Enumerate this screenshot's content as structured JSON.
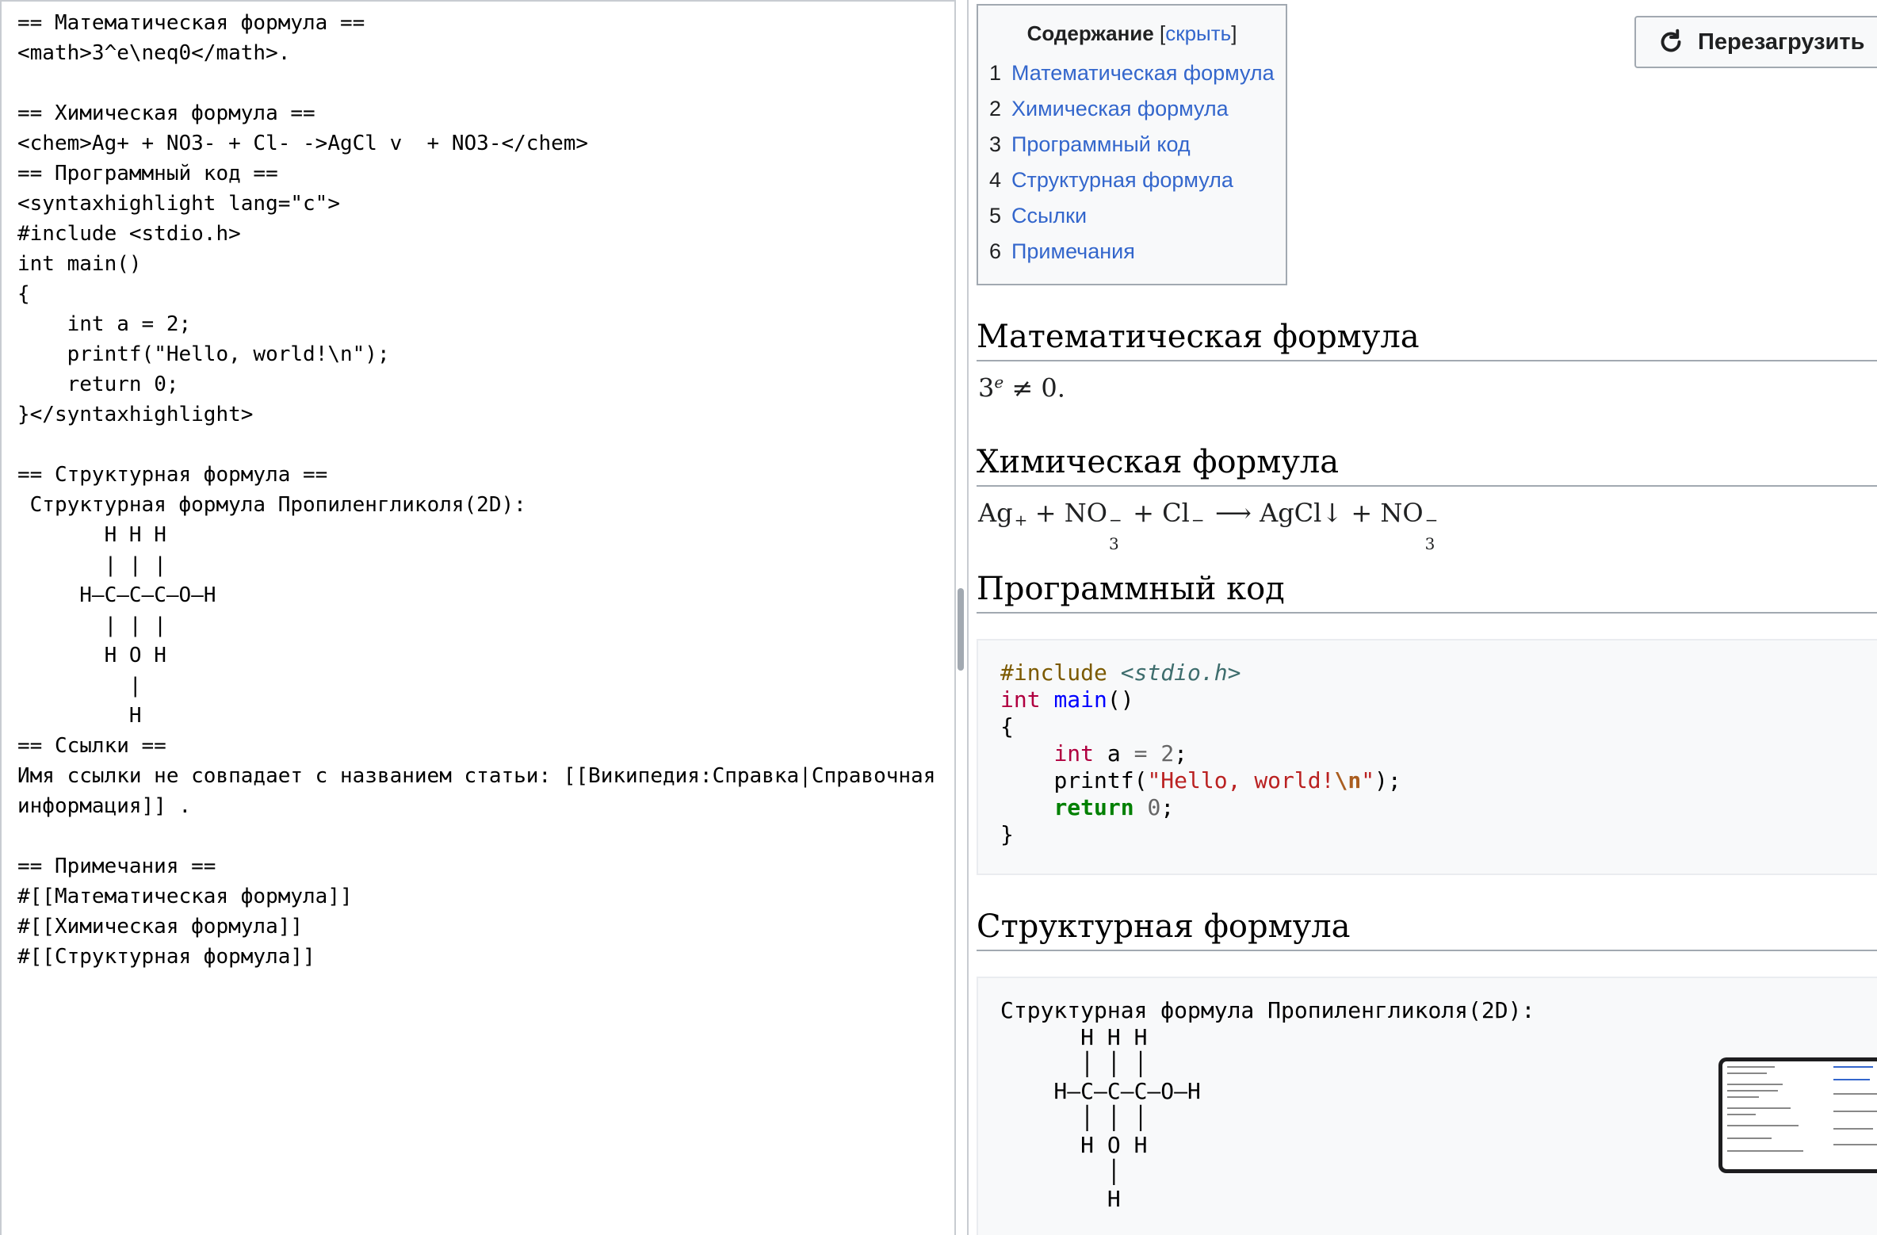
{
  "editor": {
    "text": "== Математическая формула ==\n<math>3^e\\neq0</math>.\n\n== Химическая формула ==\n<chem>Ag+ + NO3- + Cl- ->AgCl v  + NO3-</chem>\n== Программный код ==\n<syntaxhighlight lang=\"c\">\n#include <stdio.h>\nint main()\n{\n    int a = 2;\n    printf(\"Hello, world!\\n\");\n    return 0;\n}</syntaxhighlight>\n\n== Структурная формула ==\n Структурная формула Пропиленгликоля(2D):\n       H H H\n       | | |\n     H—C—C—C—O—H\n       | | |\n       H O H\n         |\n         H\n== Ссылки ==\nИмя ссылки не совпадает с названием статьи: [[Википедия:Справка|Справочная информация]] .\n\n== Примечания ==\n#[[Математическая формула]]\n#[[Химическая формула]]\n#[[Структурная формула]]"
  },
  "toc": {
    "title": "Содержание",
    "toggle_open": "[",
    "toggle": "скрыть",
    "toggle_close": "]",
    "items": [
      {
        "num": "1",
        "label": "Математическая формула"
      },
      {
        "num": "2",
        "label": "Химическая формула"
      },
      {
        "num": "3",
        "label": "Программный код"
      },
      {
        "num": "4",
        "label": "Структурная формула"
      },
      {
        "num": "5",
        "label": "Ссылки"
      },
      {
        "num": "6",
        "label": "Примечания"
      }
    ]
  },
  "reload_button": {
    "label": "Перезагрузить",
    "icon": "reload-icon"
  },
  "sections": {
    "math": {
      "heading": "Математическая формула",
      "base": "3",
      "exp": "e",
      "rel": " ≠ 0."
    },
    "chem": {
      "heading": "Химическая формула",
      "ag": "Ag",
      "ag_charge": "+",
      "plus1": " + NO",
      "no3_charge": "−",
      "no3_sub": "3",
      "plus2": " + Cl",
      "cl_charge": "−",
      "arrow": " ⟶ AgCl↓ + NO",
      "no3b_charge": "−",
      "no3b_sub": "3"
    },
    "code": {
      "heading": "Программный код"
    },
    "structure": {
      "heading": "Структурная формула",
      "text": "Структурная формула Пропиленгликоля(2D):\n      H H H\n      │ │ │\n    H—C—C—C—O—H\n      │ │ │\n      H O H\n        │\n        H"
    }
  },
  "code_tokens": {
    "pre": "#include",
    "inc": "<stdio.h>",
    "int1": "int",
    "main": "main",
    "paren": "()",
    "brace_open": "{",
    "int2": "int",
    "a": " a ",
    "eq": "=",
    "two": "2",
    "semi1": ";",
    "printf": "printf(",
    "str1": "\"Hello, world!",
    "esc": "\\n",
    "str2": "\"",
    "close1": ");",
    "ret": "return",
    "zero": "0",
    "semi2": ";",
    "brace_close": "}"
  },
  "colors": {
    "link": "#3366cc",
    "border": "#a2a9b1",
    "code_bg": "#f8f9fa"
  }
}
